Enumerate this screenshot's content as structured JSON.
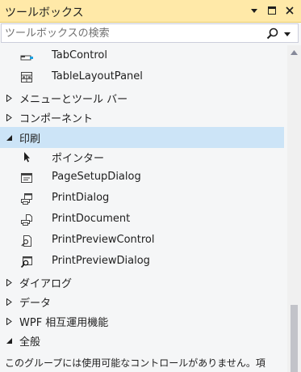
{
  "window": {
    "title": "ツールボックス"
  },
  "search": {
    "placeholder": "ツールボックスの検索"
  },
  "rows": [
    {
      "kind": "item",
      "label": "TabControl",
      "icon": "tabcontrol-icon"
    },
    {
      "kind": "item",
      "label": "TableLayoutPanel",
      "icon": "tablelayoutpanel-icon"
    },
    {
      "kind": "category",
      "label": "メニューとツール バー",
      "expanded": false
    },
    {
      "kind": "category",
      "label": "コンポーネント",
      "expanded": false
    },
    {
      "kind": "category",
      "label": "印刷",
      "expanded": true,
      "selected": true
    },
    {
      "kind": "item",
      "label": "ポインター",
      "icon": "pointer-icon"
    },
    {
      "kind": "item",
      "label": "PageSetupDialog",
      "icon": "pagesetupdialog-icon"
    },
    {
      "kind": "item",
      "label": "PrintDialog",
      "icon": "printdialog-icon"
    },
    {
      "kind": "item",
      "label": "PrintDocument",
      "icon": "printdocument-icon"
    },
    {
      "kind": "item",
      "label": "PrintPreviewControl",
      "icon": "printpreviewcontrol-icon"
    },
    {
      "kind": "item",
      "label": "PrintPreviewDialog",
      "icon": "printpreviewdialog-icon"
    },
    {
      "kind": "category",
      "label": "ダイアログ",
      "expanded": false
    },
    {
      "kind": "category",
      "label": "データ",
      "expanded": false
    },
    {
      "kind": "category",
      "label": "WPF 相互運用機能",
      "expanded": false
    },
    {
      "kind": "category",
      "label": "全般",
      "expanded": true
    }
  ],
  "general_hint": "このグループには使用可能なコントロールがありません。項",
  "colors": {
    "title_bg": "#ffe9a8",
    "selected_bg": "#cce4f7",
    "panel_bg": "#f5f6f7"
  }
}
